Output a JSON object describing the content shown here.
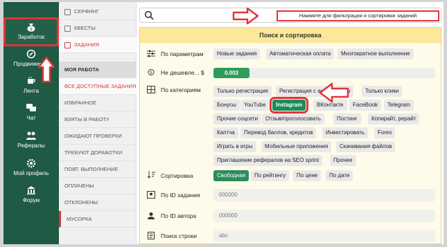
{
  "sidebar": {
    "items": [
      {
        "label": "Заработок",
        "icon": "money-bag-icon"
      },
      {
        "label": "Продвижение",
        "icon": "rocket-icon"
      },
      {
        "label": "Лента",
        "icon": "cup-icon"
      },
      {
        "label": "Чат",
        "icon": "chat-icon"
      },
      {
        "label": "Рефералы",
        "icon": "people-icon"
      },
      {
        "label": "Мой профиль",
        "icon": "gear-icon"
      },
      {
        "label": "Форум",
        "icon": "forum-icon"
      }
    ]
  },
  "menu": {
    "top": [
      {
        "label": "Серфинг",
        "icon": "monitor-icon"
      },
      {
        "label": "Квесты",
        "icon": "list-icon"
      },
      {
        "label": "Задания",
        "icon": "briefcase-icon"
      }
    ],
    "section_title": "Моя работа",
    "items": [
      "Все доступные задания",
      "Избранное",
      "Взяты в работу",
      "Ожидают проверки",
      "Требуют доработки",
      "Повт. выполнение",
      "Оплачены",
      "Отклонены",
      "Мусорка"
    ]
  },
  "search": {
    "hint": "Нажмите для фильтрации и сортировки заданий"
  },
  "panel": {
    "title": "Поиск и сортировка",
    "params_label": "По параметрам",
    "params": [
      "Новые задания",
      "Автоматическая оплата",
      "Многократное выполнение"
    ],
    "price_label": "Не дешевле... $",
    "price_value": "0.003",
    "categories_label": "По категориям",
    "categories": [
      "Только регистрация",
      "Регистрация с активностью",
      "Только клики",
      "Бонусы",
      "YouTube",
      "Instagram",
      "ВКонтакте",
      "FaceBook",
      "Telegram",
      "Прочие соцсети",
      "Отзыв/проголосовать",
      "Постинг",
      "Копирайт, рерайт",
      "Каптча",
      "Перевод баллов, кредитов",
      "Инвестировать",
      "Forex",
      "Играть в игры",
      "Мобильные приложения",
      "Скачивания файлов",
      "Приглашение рефералов на SEO sprint",
      "Прочее"
    ],
    "sort_label": "Сортировка",
    "sort": [
      "Свободная",
      "По рейтингу",
      "По цене",
      "По дате"
    ],
    "task_id_label": "По ID задания",
    "task_id_value": "000000",
    "author_id_label": "По ID автора",
    "author_id_value": "000000",
    "string_label": "Поиск строки",
    "string_value": "abc"
  },
  "colors": {
    "sidebar": "#1e5a44",
    "accent_green": "#2d8c5a",
    "highlight_red": "#e53238",
    "panel_header": "#fde79a"
  }
}
